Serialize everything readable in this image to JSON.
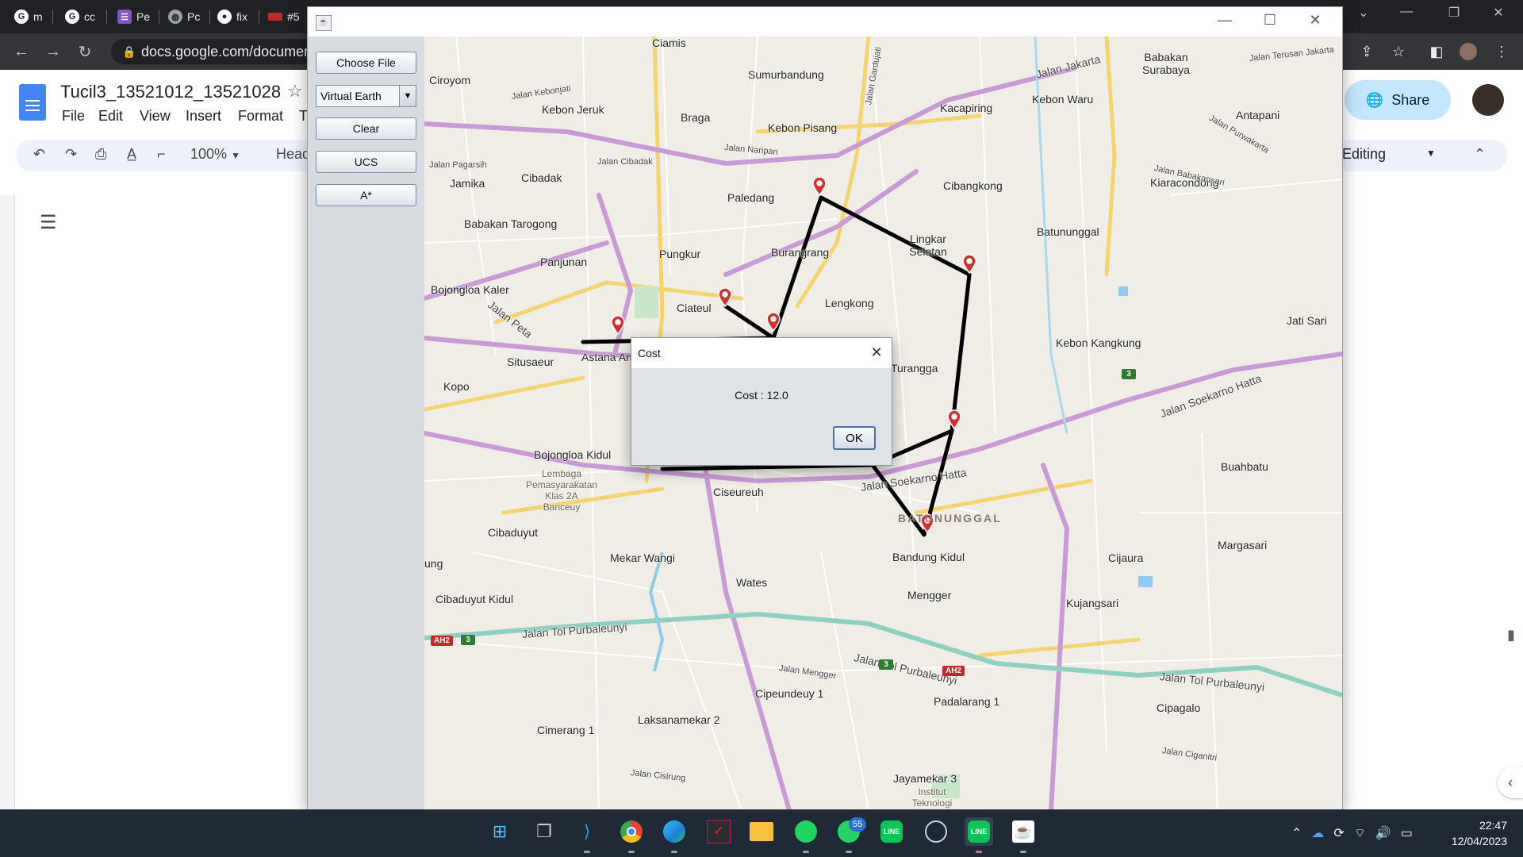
{
  "browser": {
    "tabs": [
      {
        "label": "m",
        "icon": "google-icon"
      },
      {
        "label": "cc",
        "icon": "google-icon"
      },
      {
        "label": "Pe",
        "icon": "list-icon"
      },
      {
        "label": "Pc",
        "icon": "globe-icon"
      },
      {
        "label": "fix",
        "icon": "github-icon"
      },
      {
        "label": "#5",
        "icon": "flag-icon"
      }
    ],
    "url": "docs.google.com/documen"
  },
  "docs": {
    "title": "Tucil3_13521012_13521028",
    "menu": [
      "File",
      "Edit",
      "View",
      "Insert",
      "Format",
      "T"
    ],
    "zoom": "100%",
    "style_partial": "Head",
    "share_label": "Share",
    "mode_label": "Editing"
  },
  "java_app": {
    "buttons": {
      "choose_file": "Choose File",
      "clear": "Clear",
      "ucs": "UCS",
      "astar": "A*"
    },
    "map_type": "Virtual Earth"
  },
  "map": {
    "places": [
      {
        "name": "Ciamis"
      },
      {
        "name": "Ciroyom"
      },
      {
        "name": "Sumurbandung"
      },
      {
        "name": "Kebon Jeruk"
      },
      {
        "name": "Braga"
      },
      {
        "name": "Kebon Pisang"
      },
      {
        "name": "Kacapiring"
      },
      {
        "name": "Kebon Waru"
      },
      {
        "name": "Babakan Surabaya"
      },
      {
        "name": "Antapani"
      },
      {
        "name": "Jamika"
      },
      {
        "name": "Cibadak"
      },
      {
        "name": "Paledang"
      },
      {
        "name": "Cibangkong"
      },
      {
        "name": "Kiaracondong"
      },
      {
        "name": "Babakan Tarogong"
      },
      {
        "name": "Pungkur"
      },
      {
        "name": "Burangrang"
      },
      {
        "name": "Lingkar Selatan"
      },
      {
        "name": "Batununggal"
      },
      {
        "name": "Panjunan"
      },
      {
        "name": "Bojongloa Kaler"
      },
      {
        "name": "Ciateul"
      },
      {
        "name": "Lengkong"
      },
      {
        "name": "Jati Sari"
      },
      {
        "name": "Kebon Kangkung"
      },
      {
        "name": "Situsaeur"
      },
      {
        "name": "Astana An"
      },
      {
        "name": "Turangga"
      },
      {
        "name": "Kopo"
      },
      {
        "name": "Bojongloa Kidul"
      },
      {
        "name": "Buahbatu"
      },
      {
        "name": "Lembaga Pemasyarakatan Klas 2A Banceuy"
      },
      {
        "name": "Ciseureuh"
      },
      {
        "name": "BATUNUNGGAL"
      },
      {
        "name": "Cibaduyut"
      },
      {
        "name": "Margasari"
      },
      {
        "name": "Mekar Wangi"
      },
      {
        "name": "Bandung Kidul"
      },
      {
        "name": "Cijaura"
      },
      {
        "name": "ung"
      },
      {
        "name": "Wates"
      },
      {
        "name": "Cibaduyut Kidul"
      },
      {
        "name": "Mengger"
      },
      {
        "name": "Kujangsari"
      },
      {
        "name": "Cipeundeuy 1"
      },
      {
        "name": "Padalarang 1"
      },
      {
        "name": "Cipagalo"
      },
      {
        "name": "Cimerang 1"
      },
      {
        "name": "Laksanamekar 2"
      },
      {
        "name": "Jayamekar 3"
      },
      {
        "name": "Institut Teknologi"
      }
    ],
    "roads": [
      {
        "name": "Jalan Jakarta"
      },
      {
        "name": "Jalan Kebonjati"
      },
      {
        "name": "Jalan Gardujati"
      },
      {
        "name": "Jalan Naripan"
      },
      {
        "name": "Jalan Pagarsih"
      },
      {
        "name": "Jalan Cibadak"
      },
      {
        "name": "Jalan Peta"
      },
      {
        "name": "Jalan Soekarno Hatta"
      },
      {
        "name": "Jalan Soekarno Hatta"
      },
      {
        "name": "Jalan Tol Purbaleunyi"
      },
      {
        "name": "Jalan Tol Purbaleunyi"
      },
      {
        "name": "Jalan Tol Purbaleunyi"
      },
      {
        "name": "Jalan Mengger"
      },
      {
        "name": "Jalan Cisirung"
      },
      {
        "name": "Jalan Ciganitri"
      },
      {
        "name": "Jalan Purwakarta"
      },
      {
        "name": "Jalan Babakansari"
      },
      {
        "name": "Jalan Terusan Jakarta"
      }
    ],
    "shields": [
      "AH2",
      "3",
      "3",
      "3",
      "AH2"
    ],
    "route_color": "#000000",
    "marker_color": "#d32f2f"
  },
  "dialog": {
    "title": "Cost",
    "message": "Cost : 12.0",
    "ok_label": "OK"
  },
  "taskbar": {
    "apps": [
      "windows-start-icon",
      "task-view-icon",
      "vscode-icon",
      "chrome-icon",
      "edge-icon",
      "netbeans-icon",
      "file-explorer-icon",
      "spotify-icon",
      "whatsapp-icon",
      "line-icon",
      "steam-icon",
      "line-icon",
      "java-icon"
    ],
    "whatsapp_badge": "55",
    "time": "22:47",
    "date": "12/04/2023"
  }
}
